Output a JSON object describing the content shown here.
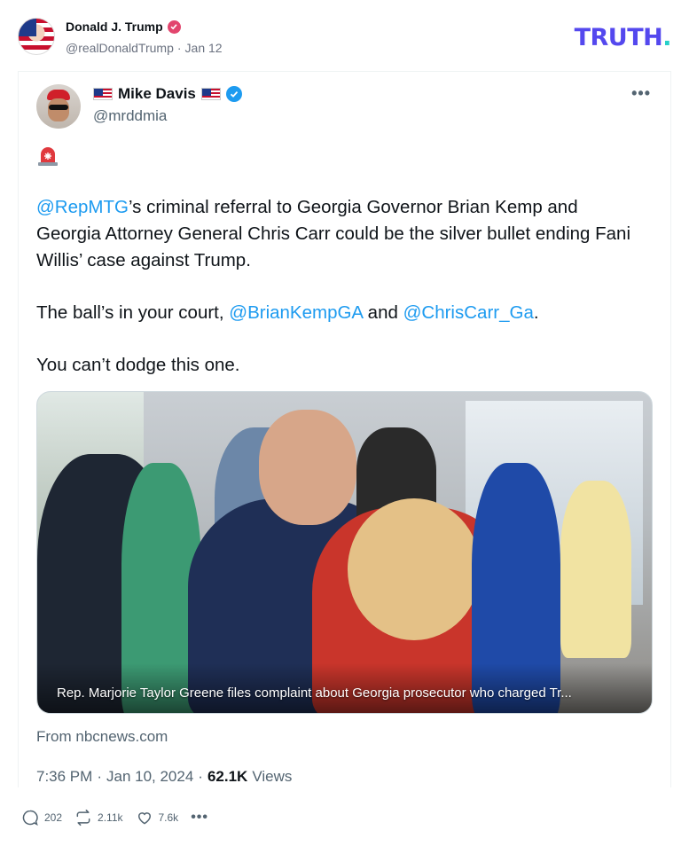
{
  "post": {
    "author_name": "Donald J. Trump",
    "author_handle": "@realDonaldTrump",
    "separator": "·",
    "date": "Jan 12"
  },
  "brand": {
    "logo_main": "TRUTH",
    "logo_dot": ".",
    "color": "#5448ee",
    "dot_color": "#26d0c9"
  },
  "tweet": {
    "author_name": "Mike Davis",
    "author_handle": "@mrddmia",
    "more_label": "•••",
    "emoji_icon": "police-siren-icon",
    "paragraph1_mention": "@RepMTG",
    "paragraph1_text": "’s criminal referral to Georgia Governor Brian Kemp and Georgia Attorney General Chris Carr could be the silver bullet ending Fani Willis’ case against Trump.",
    "paragraph2_prefix": "The ball’s in your court, ",
    "paragraph2_mention1": "@BrianKempGA",
    "paragraph2_mid": " and ",
    "paragraph2_mention2": "@ChrisCarr_Ga",
    "paragraph2_suffix": ".",
    "paragraph3": "You can’t dodge this one.",
    "media_caption": "Rep. Marjorie Taylor Greene files complaint about Georgia prosecutor who charged Tr...",
    "source": "From nbcnews.com",
    "time": "7:36 PM",
    "sep": "·",
    "date": "Jan 10, 2024",
    "sep2": "·",
    "views_count": "62.1K",
    "views_label": "Views",
    "mention_color": "#1d9bf0"
  },
  "actions": {
    "replies": "202",
    "retruths": "2.11k",
    "likes": "7.6k",
    "more": "•••"
  }
}
